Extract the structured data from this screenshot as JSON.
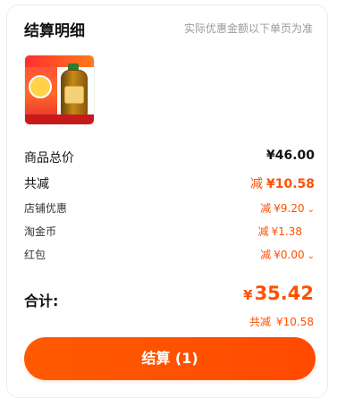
{
  "header": {
    "title": "结算明细",
    "note": "实际优惠金额以下单页为准"
  },
  "product": {
    "thumbnail": "oil-bottle-product-image"
  },
  "summary": {
    "goods_total": {
      "label": "商品总价",
      "value": "¥46.00"
    },
    "reduction": {
      "label": "共减",
      "prefix": "减",
      "value": "¥10.58"
    },
    "shop_discount": {
      "label": "店铺优惠",
      "prefix": "减",
      "value": "¥9.20"
    },
    "taojinbi": {
      "label": "淘金币",
      "prefix": "减",
      "value": "¥1.38"
    },
    "red_packet": {
      "label": "红包",
      "prefix": "减",
      "value": "¥0.00"
    }
  },
  "total": {
    "label": "合计:",
    "currency": "¥",
    "amount": "35.42",
    "reduction_prefix": "共减",
    "reduction_value": "¥10.58"
  },
  "checkout": {
    "label": "结算 (1)"
  },
  "colors": {
    "accent": "#ff5000",
    "button": "#ff5000"
  }
}
